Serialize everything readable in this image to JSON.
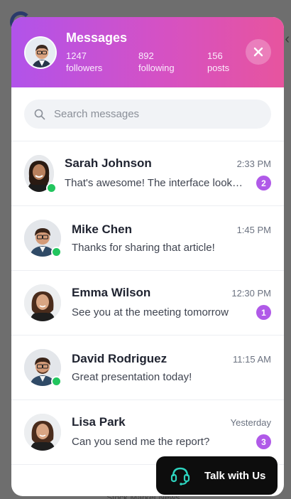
{
  "header": {
    "title": "Messages",
    "stats": [
      {
        "value": "1247",
        "label": "followers"
      },
      {
        "value": "892",
        "label": "following"
      },
      {
        "value": "156",
        "label": "posts"
      }
    ]
  },
  "search": {
    "placeholder": "Search messages",
    "value": ""
  },
  "conversations": [
    {
      "name": "Sarah Johnson",
      "time": "2:33 PM",
      "preview": "That's awesome! The interface looks amazing",
      "unread": "2",
      "online": true
    },
    {
      "name": "Mike Chen",
      "time": "1:45 PM",
      "preview": "Thanks for sharing that article!",
      "unread": "",
      "online": true
    },
    {
      "name": "Emma Wilson",
      "time": "12:30 PM",
      "preview": "See you at the meeting tomorrow",
      "unread": "1",
      "online": false
    },
    {
      "name": "David Rodriguez",
      "time": "11:15 AM",
      "preview": "Great presentation today!",
      "unread": "",
      "online": true
    },
    {
      "name": "Lisa Park",
      "time": "Yesterday",
      "preview": "Can you send me the report?",
      "unread": "3",
      "online": false
    }
  ],
  "talk_button": {
    "label": "Talk with Us"
  },
  "background": {
    "footer_text": "Stock Market News"
  },
  "colors": {
    "accent": "#b05ae8",
    "online": "#22c55e",
    "header_start": "#b153ea",
    "header_end": "#e7549e"
  }
}
